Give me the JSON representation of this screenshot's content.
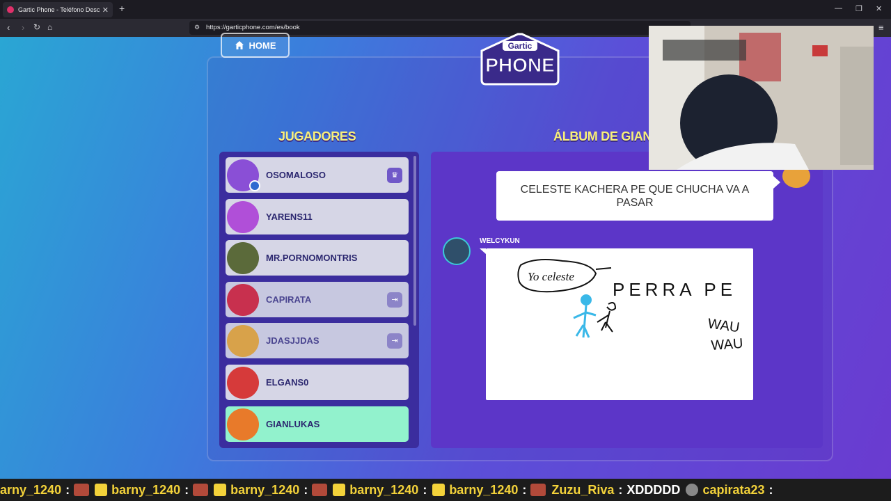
{
  "browser": {
    "tab_title": "Gartic Phone - Teléfono Descomp",
    "url": "https://garticphone.com/es/book"
  },
  "page": {
    "home_label": "HOME",
    "players_title": "JUGADORES",
    "album_title": "ÁLBUM DE GIAN",
    "logo_line1": "Gartic",
    "logo_line2": "PHONE"
  },
  "players": [
    {
      "name": "OSOMALOSO",
      "badge": "crown-icon",
      "avatar_color": "#8a4fd6"
    },
    {
      "name": "YARENS11",
      "badge": "",
      "avatar_color": "#b04fd8"
    },
    {
      "name": "MR.PORNOMONTRIS",
      "badge": "",
      "avatar_color": "#5b6a3a"
    },
    {
      "name": "CAPIRATA",
      "badge": "exit-icon",
      "avatar_color": "#c8304e"
    },
    {
      "name": "JDASJJDAS",
      "badge": "exit-icon",
      "avatar_color": "#d8a24a"
    },
    {
      "name": "ELGANS0",
      "badge": "",
      "avatar_color": "#d63a3a"
    },
    {
      "name": "GIANLUKAS",
      "badge": "",
      "avatar_color": "#e87a2a"
    }
  ],
  "album": {
    "phrase": "CELESTE KACHERA PE QUE CHUCHA VA A PASAR",
    "author": "WELCYKUN",
    "drawing_text_1": "Yo celeste",
    "drawing_text_2": "PERRA PE",
    "drawing_text_3": "WAU",
    "drawing_text_4": "WAU"
  },
  "ticker": [
    {
      "user": "arny_1240",
      "msg": ""
    },
    {
      "user": "barny_1240",
      "msg": ""
    },
    {
      "user": "barny_1240",
      "msg": ""
    },
    {
      "user": "barny_1240",
      "msg": ""
    },
    {
      "user": "barny_1240",
      "msg": ""
    },
    {
      "user": "Zuzu_Riva",
      "msg": "XDDDDD"
    },
    {
      "user": "capirata23",
      "msg": ""
    }
  ],
  "colors": {
    "accent_yellow": "#f8f07a",
    "self_highlight": "#92f2cd"
  }
}
